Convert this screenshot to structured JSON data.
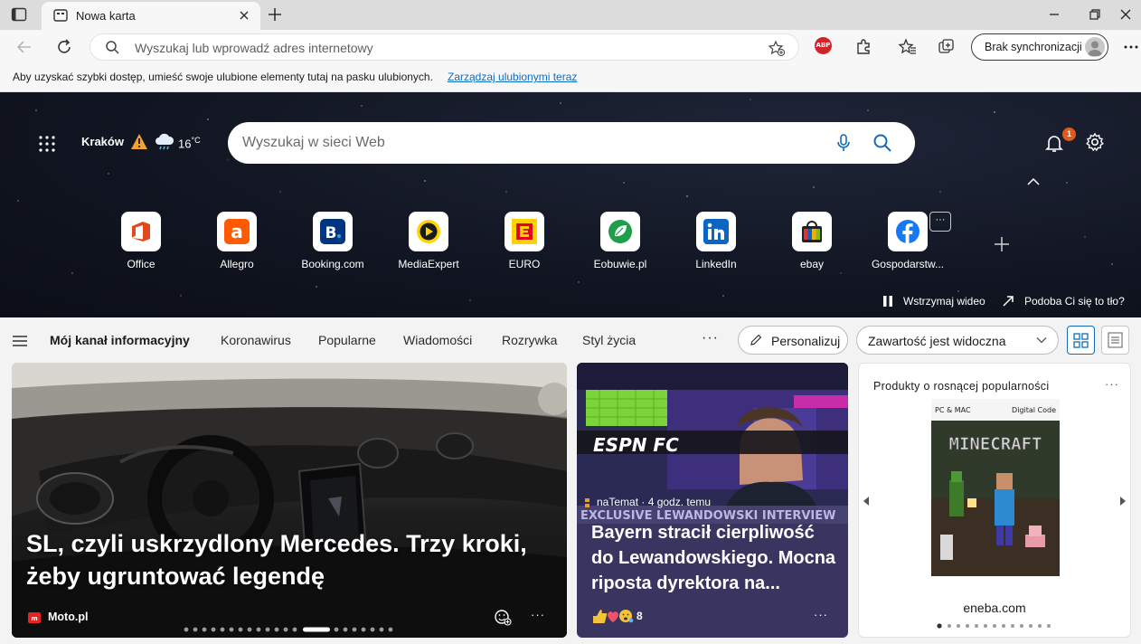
{
  "tab": {
    "title": "Nowa karta"
  },
  "address_bar": {
    "placeholder": "Wyszukaj lub wprowadź adres internetowy"
  },
  "toolbar": {
    "abp_label": "ABP",
    "sync_label": "Brak synchronizacji",
    "menu_label": "···"
  },
  "favorites_bar": {
    "text": "Aby uzyskać szybki dostęp, umieść swoje ulubione elementy tutaj na pasku ulubionych.",
    "link": "Zarządzaj ulubionymi teraz"
  },
  "hero": {
    "city": "Kraków",
    "temperature": "16",
    "temp_unit": "°C",
    "search_placeholder": "Wyszukaj w sieci Web",
    "notification_count": "1",
    "pause_label": "Wstrzymaj wideo",
    "like_label": "Podoba Ci się to tło?"
  },
  "quick_links": [
    {
      "label": "Office",
      "icon": "office-icon"
    },
    {
      "label": "Allegro",
      "icon": "allegro-icon"
    },
    {
      "label": "Booking.com",
      "icon": "booking-icon"
    },
    {
      "label": "MediaExpert",
      "icon": "mediaexpert-icon"
    },
    {
      "label": "EURO",
      "icon": "euro-icon"
    },
    {
      "label": "Eobuwie.pl",
      "icon": "eobuwie-icon"
    },
    {
      "label": "LinkedIn",
      "icon": "linkedin-icon"
    },
    {
      "label": "ebay",
      "icon": "ebay-icon"
    },
    {
      "label": "Gospodarstw...",
      "icon": "facebook-icon"
    }
  ],
  "tile_more": "···",
  "feed_nav": {
    "tabs": [
      "Mój kanał informacyjny",
      "Koronawirus",
      "Popularne",
      "Wiadomości",
      "Rozrywka",
      "Styl życia"
    ],
    "more": "···",
    "personalize": "Personalizuj",
    "content_visibility": "Zawartość jest widoczna"
  },
  "cards": {
    "main": {
      "headline": "SL, czyli uskrzydlony Mercedes. Trzy kroki, żeby ugruntować legendę",
      "source": "Moto.pl",
      "more": "···"
    },
    "middle": {
      "image_text_logo": "ESPN FC",
      "image_banner": "EXCLUSIVE LEWANDOWSKI INTERVIEW",
      "meta": "naTemat · 4 godz. temu",
      "title": "Bayern stracił cierpliwość do Lewandowskiego. Mocna riposta dyrektora na...",
      "reaction_count": "8",
      "more": "···"
    },
    "right": {
      "title": "Produkty o rosnącej popularności",
      "product_tag_left": "PC & MAC",
      "product_tag_right": "Digital Code",
      "product_name": "MINECRAFT",
      "shop": "eneba.com",
      "more": "···"
    }
  },
  "colors": {
    "accent": "#0f6cbd",
    "badge": "#e3581b",
    "abp": "#d2232a"
  }
}
